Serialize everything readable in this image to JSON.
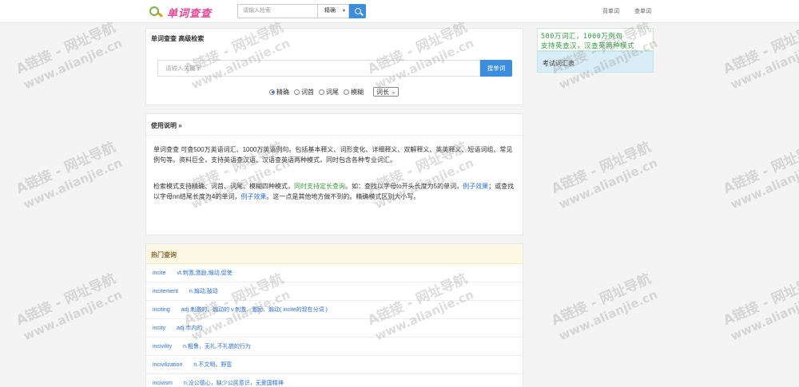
{
  "header": {
    "logo_text": "单词查查",
    "search_placeholder": "请输入检索",
    "mode_value": "精确",
    "link_recite": "背单词",
    "link_search": "查单词"
  },
  "search_panel": {
    "title": "单词查查 高级检索",
    "placeholder": "请输入关键字",
    "button": "搜单词",
    "modes": [
      {
        "label": "精确",
        "checked": true
      },
      {
        "label": "词首",
        "checked": false
      },
      {
        "label": "词尾",
        "checked": false
      },
      {
        "label": "模糊",
        "checked": false
      }
    ],
    "length_select": "词长"
  },
  "usage": {
    "title": "使用说明 »",
    "para1": "单词查查 可查500万英语词汇、1000万英语例句。包括基本释义、词形变化、详细释义、双解释义、英英释义、短语词组、常见例句等。资料巨全，支持英语查汉语、汉语查英语两种模式，同时包含各种专业词汇。",
    "p2_a": "检索模式支持精确、词首、词尾、模糊四种模式，",
    "p2_green": "同时支持定长查询",
    "p2_b": "。如：查找以字母to开头长度为5的单词，",
    "p2_link1": "例子效果",
    "p2_c": "；或查找以字母nn结尾长度为4的单词，",
    "p2_link2": "例子效果",
    "p2_d": "。这一点是其他地方做不到的。精确模式区别大小写。"
  },
  "hot": {
    "title": "热门查询",
    "rows": [
      {
        "word": "incite",
        "def": "vt.刺激,激励,煽动,促使"
      },
      {
        "word": "incitement",
        "def": "n.煽动,鼓动"
      },
      {
        "word": "inciting",
        "def": "adj.刺激的、煽动的 v.刺激、激励、煽动( incite的现在分词 )"
      },
      {
        "word": "incity",
        "def": "adj.市内的"
      },
      {
        "word": "incivility",
        "def": "n.粗鲁，无礼,不礼貌的行为"
      },
      {
        "word": "incivilization",
        "def": "n.不文明，野蛮"
      },
      {
        "word": "incivism",
        "def": "n.没公德心，缺少公民意识，无爱国精神"
      }
    ]
  },
  "sidebar": {
    "ad_line1": "500万词汇，1000万例句",
    "ad_line2": "支持英查汉，汉查英两种模式",
    "vocab_title": "考试词汇表"
  },
  "watermark": {
    "line1": "A链接 - 网址导航",
    "line2": "www.alianjie.cn"
  }
}
